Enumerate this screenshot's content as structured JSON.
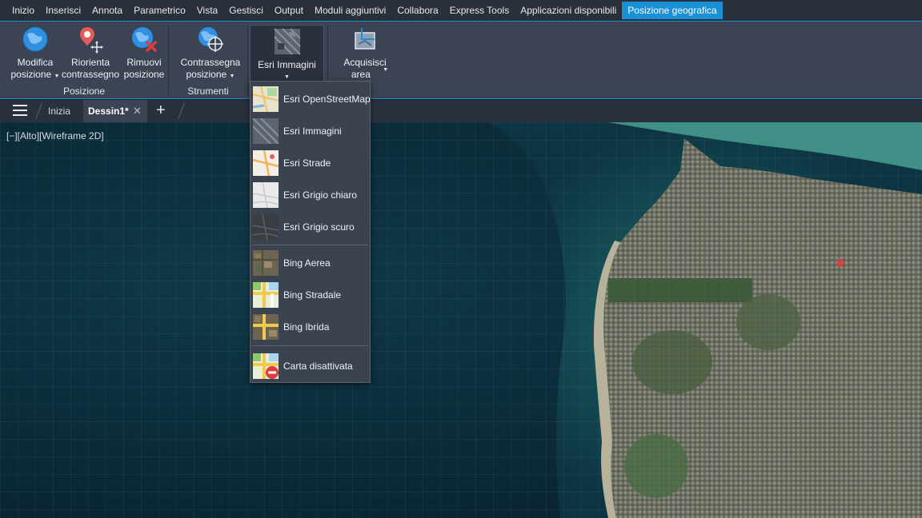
{
  "menubar": {
    "items": [
      "Inizio",
      "Inserisci",
      "Annota",
      "Parametrico",
      "Vista",
      "Gestisci",
      "Output",
      "Moduli aggiuntivi",
      "Collabora",
      "Express Tools",
      "Applicazioni disponibili",
      "Posizione geografica"
    ],
    "active_index": 11
  },
  "ribbon": {
    "posizione_panel": {
      "label": "Posizione",
      "modifica": [
        "Modifica",
        "posizione"
      ],
      "riorienta": [
        "Riorienta",
        "contrassegno"
      ],
      "rimuovi": [
        "Rimuovi",
        "posizione"
      ]
    },
    "strumenti_panel": {
      "label": "Strumenti",
      "contrassegna": [
        "Contrassegna",
        "posizione"
      ]
    },
    "map_button": {
      "label": "Esri Immagini"
    },
    "acquisisci": [
      "Acquisisci",
      "area"
    ]
  },
  "tabs": {
    "home": "Inizia",
    "active": "Dessin1*"
  },
  "viewport": {
    "label": "[−][Alto][Wireframe 2D]"
  },
  "dropdown": {
    "items": [
      {
        "label": "Esri OpenStreetMap",
        "icon": "osm-map-icon"
      },
      {
        "label": "Esri Immagini",
        "icon": "imagery-map-icon"
      },
      {
        "label": "Esri Strade",
        "icon": "streets-map-icon"
      },
      {
        "label": "Esri Grigio chiaro",
        "icon": "light-gray-map-icon"
      },
      {
        "label": "Esri Grigio scuro",
        "icon": "dark-gray-map-icon"
      },
      {
        "label": "Bing Aerea",
        "icon": "bing-aerial-icon"
      },
      {
        "label": "Bing Stradale",
        "icon": "bing-road-icon"
      },
      {
        "label": "Bing Ibrida",
        "icon": "bing-hybrid-icon"
      },
      {
        "label": "Carta disattivata",
        "icon": "map-off-icon"
      }
    ]
  },
  "colors": {
    "accent": "#1a90d6",
    "ribbon_bg": "#3c4453",
    "menubar_bg": "#2a303a"
  }
}
